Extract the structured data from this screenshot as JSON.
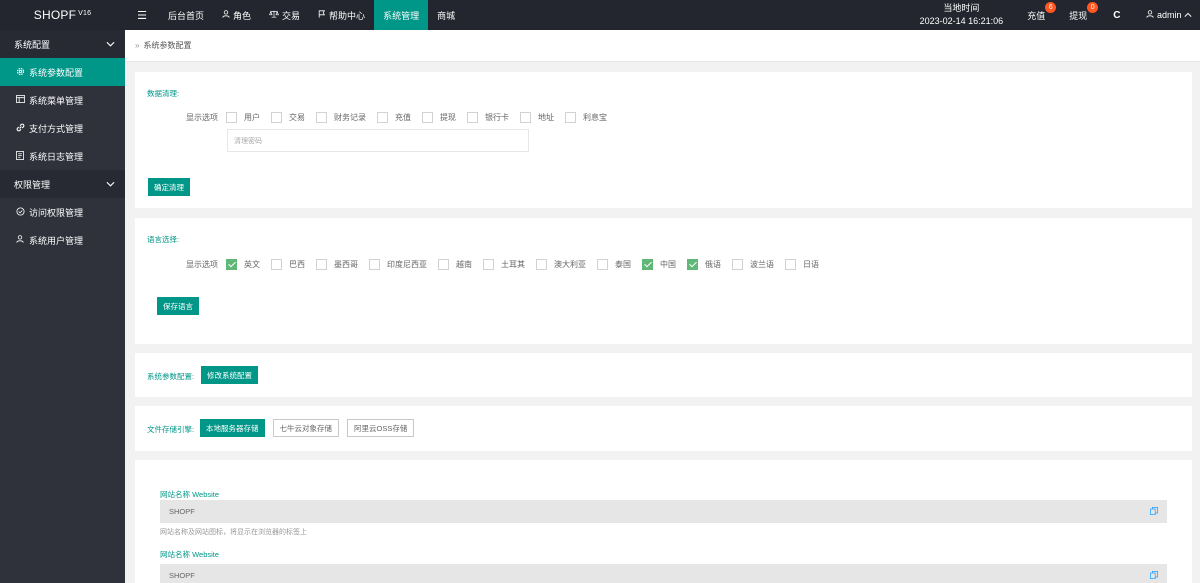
{
  "brand": {
    "name": "SHOPF",
    "version": "V16"
  },
  "nav": {
    "menu_icon": "☰",
    "items": [
      {
        "label": "后台首页",
        "icon": ""
      },
      {
        "label": "角色",
        "icon": "user-icon"
      },
      {
        "label": "交易",
        "icon": "scale-icon"
      },
      {
        "label": "帮助中心",
        "icon": "flag-icon"
      },
      {
        "label": "系统管理",
        "icon": "",
        "active": true
      },
      {
        "label": "商城",
        "icon": ""
      }
    ]
  },
  "header_right": {
    "time_label": "当地时间",
    "time_value": "2023-02-14 16:21:06",
    "recharge": {
      "label": "充值",
      "badge": "6"
    },
    "withdraw": {
      "label": "提现",
      "badge": "0"
    },
    "refresh_icon": "refresh-icon",
    "user": "admin"
  },
  "sidebar": {
    "groups": [
      {
        "title": "系统配置",
        "items": [
          {
            "label": "系统参数配置",
            "icon": "gear-icon",
            "active": true
          },
          {
            "label": "系统菜单管理",
            "icon": "menu-icon"
          },
          {
            "label": "支付方式管理",
            "icon": "link-icon"
          },
          {
            "label": "系统日志管理",
            "icon": "log-icon"
          }
        ]
      },
      {
        "title": "权限管理",
        "items": [
          {
            "label": "访问权限管理",
            "icon": "shield-check-icon"
          },
          {
            "label": "系统用户管理",
            "icon": "user-icon"
          }
        ]
      }
    ]
  },
  "breadcrumb": {
    "sep": "»",
    "current": "系统参数配置"
  },
  "data_clear": {
    "title": "数据清理:",
    "options_label": "显示选项",
    "options": [
      {
        "label": "用户",
        "checked": false
      },
      {
        "label": "交易",
        "checked": false
      },
      {
        "label": "财务记录",
        "checked": false
      },
      {
        "label": "充值",
        "checked": false
      },
      {
        "label": "提现",
        "checked": false
      },
      {
        "label": "银行卡",
        "checked": false
      },
      {
        "label": "地址",
        "checked": false
      },
      {
        "label": "利息宝",
        "checked": false
      }
    ],
    "password_placeholder": "清理密码",
    "confirm_button": "确定清理"
  },
  "language": {
    "title": "语言选择:",
    "options_label": "显示选项",
    "options": [
      {
        "label": "英文",
        "checked": true
      },
      {
        "label": "巴西",
        "checked": false
      },
      {
        "label": "墨西哥",
        "checked": false
      },
      {
        "label": "印度尼西亚",
        "checked": false
      },
      {
        "label": "越南",
        "checked": false
      },
      {
        "label": "土耳其",
        "checked": false
      },
      {
        "label": "澳大利亚",
        "checked": false
      },
      {
        "label": "泰国",
        "checked": false
      },
      {
        "label": "中国",
        "checked": true
      },
      {
        "label": "俄语",
        "checked": true
      },
      {
        "label": "波兰语",
        "checked": false
      },
      {
        "label": "日语",
        "checked": false
      }
    ],
    "save_button": "保存语言"
  },
  "system_params": {
    "title": "系统参数配置:",
    "edit_button": "修改系统配置"
  },
  "storage": {
    "title": "文件存储引擎:",
    "buttons": [
      {
        "label": "本地服务器存储",
        "active": true
      },
      {
        "label": "七牛云对象存储",
        "active": false
      },
      {
        "label": "阿里云OSS存储",
        "active": false
      }
    ]
  },
  "site": {
    "fields": [
      {
        "label": "网站名称 Website",
        "value": "SHOPF",
        "hint": "网站名称及网站图标，将显示在浏览器的标签上"
      },
      {
        "label": "网站名称 Website",
        "value": "SHOPF",
        "hint": ""
      }
    ],
    "copy_icon": "copy-icon"
  },
  "colors": {
    "accent": "#009688",
    "topbar": "#23262e",
    "sidebar": "#2f323b",
    "badge": "#ff5722",
    "checked": "#5fb878"
  }
}
